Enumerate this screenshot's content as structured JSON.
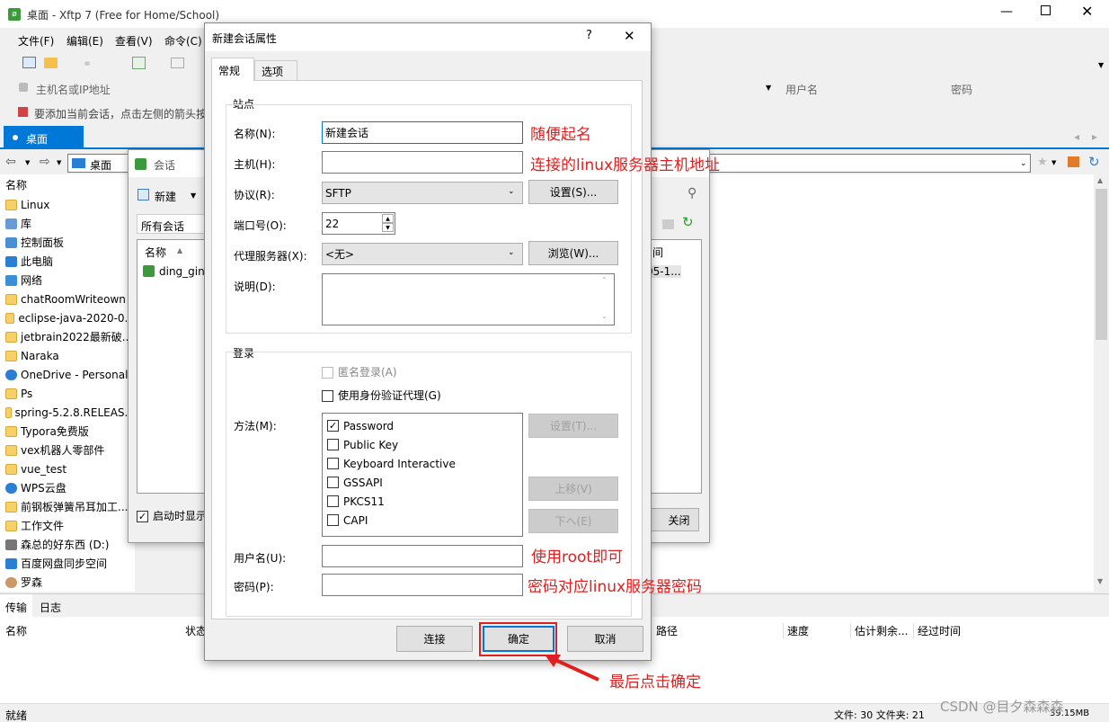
{
  "window": {
    "title": "桌面 - Xftp 7 (Free for Home/School)"
  },
  "menu": [
    "文件(F)",
    "编辑(E)",
    "查看(V)",
    "命令(C)"
  ],
  "address_bar": {
    "host_placeholder": "主机名或IP地址",
    "username_label": "用户名",
    "password_label": "密码"
  },
  "hint_text": "要添加当前会话，点击左侧的箭头按",
  "tab_desktop": "桌面",
  "left_path": "桌面",
  "left_tree_header": "名称",
  "left_tree": [
    {
      "label": "Linux",
      "icon": "folder"
    },
    {
      "label": "库",
      "icon": "library"
    },
    {
      "label": "控制面板",
      "icon": "control-panel"
    },
    {
      "label": "此电脑",
      "icon": "computer"
    },
    {
      "label": "网络",
      "icon": "network"
    },
    {
      "label": "chatRoomWriteown",
      "icon": "folder"
    },
    {
      "label": "eclipse-java-2020-0...",
      "icon": "folder"
    },
    {
      "label": "jetbrain2022最新破...",
      "icon": "folder"
    },
    {
      "label": "Naraka",
      "icon": "folder"
    },
    {
      "label": "OneDrive - Personal",
      "icon": "cloud"
    },
    {
      "label": "Ps",
      "icon": "folder"
    },
    {
      "label": "spring-5.2.8.RELEAS...",
      "icon": "folder"
    },
    {
      "label": "Typora免费版",
      "icon": "folder"
    },
    {
      "label": "vex机器人零部件",
      "icon": "folder"
    },
    {
      "label": "vue_test",
      "icon": "folder"
    },
    {
      "label": "WPS云盘",
      "icon": "cloud"
    },
    {
      "label": "前钢板弹簧吊耳加工...",
      "icon": "folder"
    },
    {
      "label": "工作文件",
      "icon": "folder"
    },
    {
      "label": "森总的好东西 (D:)",
      "icon": "drive"
    },
    {
      "label": "百度网盘同步空间",
      "icon": "baidu"
    },
    {
      "label": "罗森",
      "icon": "user"
    }
  ],
  "sessions_window": {
    "title": "会话",
    "new_button": "新建",
    "all_sessions": "所有会话",
    "col_name": "名称",
    "col_time": "间",
    "row_name": "ding_gin_",
    "row_time": "05-1...",
    "startup_checkbox": "启动时显示",
    "close_button": "关闭"
  },
  "bottom_panel": {
    "tab_transfer": "传输",
    "tab_log": "日志",
    "col_name": "名称",
    "col_status": "状态",
    "col_path": "路径",
    "col_speed": "速度",
    "col_remaining": "估计剩余...",
    "col_elapsed": "经过时间"
  },
  "status_bar": {
    "ready": "就绪",
    "counts": "文件: 30 文件夹: 21",
    "size": "39.15MB",
    "watermark": "CSDN @目夕森森森"
  },
  "dialog": {
    "title": "新建会话属性",
    "help": "?",
    "tabs": [
      "常规",
      "选项"
    ],
    "site_group": "站点",
    "name_label": "名称(N):",
    "name_value": "新建会话",
    "host_label": "主机(H):",
    "host_value": "",
    "protocol_label": "协议(R):",
    "protocol_value": "SFTP",
    "settings_button": "设置(S)...",
    "port_label": "端口号(O):",
    "port_value": "22",
    "proxy_label": "代理服务器(X):",
    "proxy_value": "<无>",
    "browse_button": "浏览(W)...",
    "desc_label": "说明(D):",
    "login_group": "登录",
    "anonymous_label": "匿名登录(A)",
    "agent_label": "使用身份验证代理(G)",
    "method_label": "方法(M):",
    "methods": [
      {
        "label": "Password",
        "checked": true
      },
      {
        "label": "Public Key",
        "checked": false
      },
      {
        "label": "Keyboard Interactive",
        "checked": false
      },
      {
        "label": "GSSAPI",
        "checked": false
      },
      {
        "label": "PKCS11",
        "checked": false
      },
      {
        "label": "CAPI",
        "checked": false
      }
    ],
    "method_settings_button": "设置(T)...",
    "move_up_button": "上移(V)",
    "move_down_button": "下へ(E)",
    "username_label": "用户名(U):",
    "password_label": "密码(P):",
    "connect_button": "连接",
    "ok_button": "确定",
    "cancel_button": "取消"
  },
  "annotations": {
    "name": "随便起名",
    "host": "连接的linux服务器主机地址",
    "username": "使用root即可",
    "password": "密码对应linux服务器密码",
    "final": "最后点击确定"
  },
  "colors": {
    "accent": "#0078d7",
    "annotation_red": "#e02020",
    "folder_yellow": "#f5d06b"
  }
}
